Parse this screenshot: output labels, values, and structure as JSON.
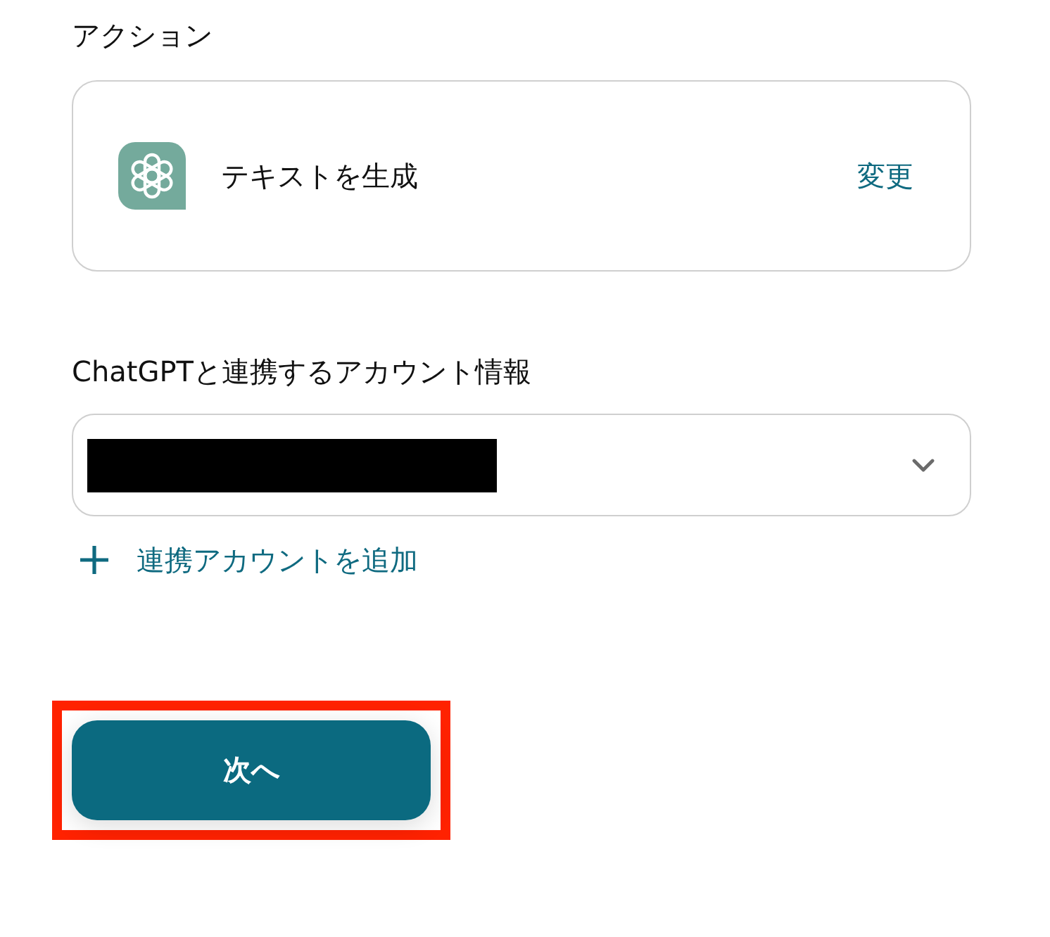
{
  "section": {
    "title": "アクション"
  },
  "action_card": {
    "name": "テキストを生成",
    "change_link": "変更"
  },
  "account": {
    "label": "ChatGPTと連携するアカウント情報",
    "select": {
      "value_redacted": true
    },
    "add_link": "連携アカウントを追加"
  },
  "next_button": {
    "label": "次へ",
    "highlighted": true
  }
}
